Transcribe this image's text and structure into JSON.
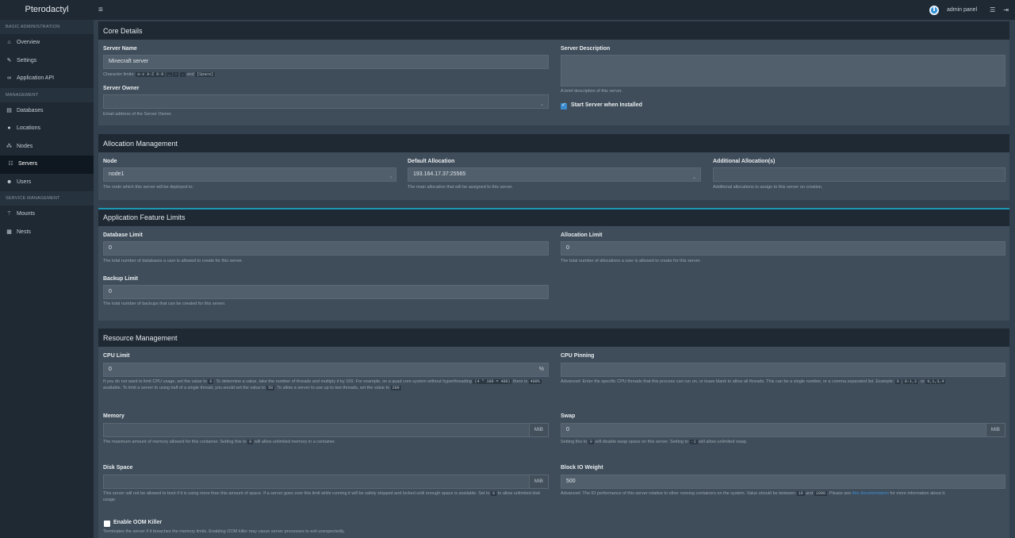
{
  "topbar": {
    "brand": "Pterodactyl",
    "user": "admin panel"
  },
  "sidebar": {
    "sections": [
      {
        "header": "BASIC ADMINISTRATION",
        "items": [
          {
            "label": "Overview",
            "icon": "home-icon"
          },
          {
            "label": "Settings",
            "icon": "wrench-icon"
          },
          {
            "label": "Application API",
            "icon": "link-icon"
          }
        ]
      },
      {
        "header": "MANAGEMENT",
        "items": [
          {
            "label": "Databases",
            "icon": "database-icon"
          },
          {
            "label": "Locations",
            "icon": "globe-icon"
          },
          {
            "label": "Nodes",
            "icon": "sitemap-icon"
          },
          {
            "label": "Servers",
            "icon": "server-icon",
            "active": true
          },
          {
            "label": "Users",
            "icon": "users-icon"
          }
        ]
      },
      {
        "header": "SERVICE MANAGEMENT",
        "items": [
          {
            "label": "Mounts",
            "icon": "magic-icon"
          },
          {
            "label": "Nests",
            "icon": "th-large-icon"
          }
        ]
      }
    ]
  },
  "core": {
    "title": "Core Details",
    "server_name_label": "Server Name",
    "server_name_value": "Minecraft server",
    "char_limits_prefix": "Character limits:",
    "char_limits_codes": [
      "a-z A-Z 0-9",
      "_",
      "-",
      "."
    ],
    "char_limits_and": "and",
    "char_limits_space": "[Space]",
    "owner_label": "Server Owner",
    "owner_help": "Email address of the Server Owner.",
    "desc_label": "Server Description",
    "desc_help": "A brief description of this server.",
    "start_label": "Start Server when Installed",
    "start_checked": true
  },
  "allocation": {
    "title": "Allocation Management",
    "node_label": "Node",
    "node_value": "node1",
    "node_help": "The node which this server will be deployed to.",
    "default_label": "Default Allocation",
    "default_value": "193.164.17.37:25565",
    "default_help": "The main allocation that will be assigned to this server.",
    "additional_label": "Additional Allocation(s)",
    "additional_help": "Additional allocations to assign to this server on creation."
  },
  "limits": {
    "title": "Application Feature Limits",
    "db_label": "Database Limit",
    "db_value": "0",
    "db_help": "The total number of databases a user is allowed to create for this server.",
    "alloc_label": "Allocation Limit",
    "alloc_value": "0",
    "alloc_help": "The total number of allocations a user is allowed to create for this server.",
    "backup_label": "Backup Limit",
    "backup_value": "0",
    "backup_help": "The total number of backups that can be created for this server."
  },
  "resources": {
    "title": "Resource Management",
    "cpu_label": "CPU Limit",
    "cpu_value": "0",
    "cpu_unit": "%",
    "cpu_help_1": "If you do not want to limit CPU usage, set the value to",
    "cpu_help_code1": "0",
    "cpu_help_2": ". To determine a value, take the number of threads and multiply it by 100. For example, on a quad core system without hyperthreading",
    "cpu_help_code2": "(4 * 100 = 400)",
    "cpu_help_3": "there is",
    "cpu_help_code3": "400%",
    "cpu_help_4": "available. To limit a server to using half of a single thread, you would set the value to",
    "cpu_help_code4": "50",
    "cpu_help_5": ". To allow a server to use up to two threads, set the value to",
    "cpu_help_code5": "200",
    "cpu_help_6": ".",
    "pin_label": "CPU Pinning",
    "pin_help_1": "Advanced: Enter the specific CPU threads that this process can run on, or leave blank to allow all threads. This can be a single number, or a comma separated list. Example:",
    "pin_code1": "0",
    "pin_code2": "0-1,3",
    "pin_or": ", or",
    "pin_code3": "0,1,3,4",
    "mem_label": "Memory",
    "mem_unit": "MiB",
    "mem_help_1": "The maximum amount of memory allowed for this container. Setting this to",
    "mem_code": "0",
    "mem_help_2": "will allow unlimited memory in a container.",
    "swap_label": "Swap",
    "swap_value": "0",
    "swap_unit": "MiB",
    "swap_help_1": "Setting this to",
    "swap_code1": "0",
    "swap_help_2": "will disable swap space on this server. Setting to",
    "swap_code2": "-1",
    "swap_help_3": "will allow unlimited swap.",
    "disk_label": "Disk Space",
    "disk_unit": "MiB",
    "disk_help_1": "This server will not be allowed to boot if it is using more than this amount of space. If a server goes over this limit while running it will be safely stopped and locked until enough space is available. Set to",
    "disk_code": "0",
    "disk_help_2": "to allow unlimited disk usage.",
    "io_label": "Block IO Weight",
    "io_value": "500",
    "io_help_1": "Advanced: The IO performance of this server relative to other running containers on the system. Value should be between",
    "io_code1": "10",
    "io_and": "and",
    "io_code2": "1000",
    "io_help_2": ". Please see",
    "io_link": "this documentation",
    "io_help_3": "for more information about it.",
    "oom_label": "Enable OOM Killer",
    "oom_checked": false,
    "oom_help": "Terminates the server if it breaches the memory limits. Enabling OOM killer may cause server processes to exit unexpectedly."
  }
}
